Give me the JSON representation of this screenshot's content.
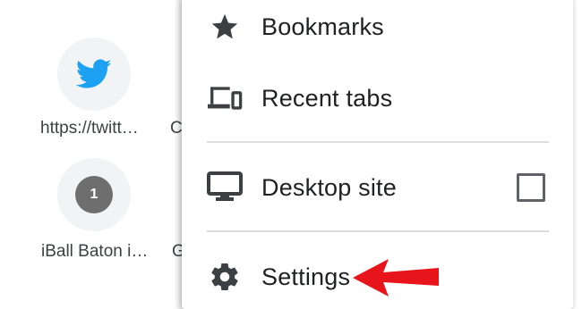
{
  "tiles": [
    {
      "label": "https://twitt…",
      "icon": "twitter-icon"
    },
    {
      "label": "C",
      "icon": ""
    },
    {
      "label": "iBall Baton i…",
      "badge": "1"
    },
    {
      "label": "G",
      "icon": ""
    }
  ],
  "menu": {
    "bookmarks_label": "Bookmarks",
    "recent_tabs_label": "Recent tabs",
    "desktop_site_label": "Desktop site",
    "settings_label": "Settings"
  },
  "colors": {
    "twitter_blue": "#1da1f2",
    "arrow_red": "#e8141b",
    "icon_gray": "#3c4043"
  }
}
